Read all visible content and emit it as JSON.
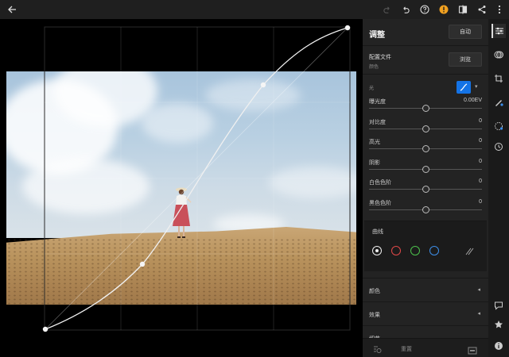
{
  "topbar": {
    "icons": [
      "back-arrow-icon",
      "redo-icon",
      "undo-icon",
      "help-icon",
      "alert-icon",
      "compare-icon",
      "share-icon",
      "more-icon"
    ]
  },
  "panel": {
    "title": "调整",
    "auto_label": "自动",
    "profile": {
      "label": "配置文件",
      "value": "颜色",
      "browse_label": "浏览"
    },
    "light": {
      "section_label": "光",
      "sliders": [
        {
          "label": "曝光度",
          "value": "0.00EV",
          "position": 0.5
        },
        {
          "label": "对比度",
          "value": "0",
          "position": 0.5
        },
        {
          "label": "高光",
          "value": "0",
          "position": 0.5
        },
        {
          "label": "阴影",
          "value": "0",
          "position": 0.5
        },
        {
          "label": "白色色阶",
          "value": "0",
          "position": 0.5
        },
        {
          "label": "黑色色阶",
          "value": "0",
          "position": 0.5
        }
      ]
    },
    "curves": {
      "title": "曲线",
      "channels": [
        {
          "name": "rgb-channel",
          "color": "#ffffff"
        },
        {
          "name": "red-channel",
          "color": "#e04848"
        },
        {
          "name": "green-channel",
          "color": "#4cc04c"
        },
        {
          "name": "blue-channel",
          "color": "#3d8ee8"
        }
      ]
    },
    "sections": [
      {
        "label": "颜色"
      },
      {
        "label": "效果"
      },
      {
        "label": "细节"
      }
    ],
    "bottom": {
      "reset_label": "重置"
    }
  },
  "strip": {
    "icons": [
      "adjust-sliders-icon",
      "presets-icon",
      "crop-icon",
      "heal-brush-icon",
      "selective-icon",
      "history-icon",
      "comment-icon",
      "star-icon",
      "info-icon"
    ]
  },
  "colors": {
    "accent": "#1473e6",
    "alert": "#f0a020"
  }
}
